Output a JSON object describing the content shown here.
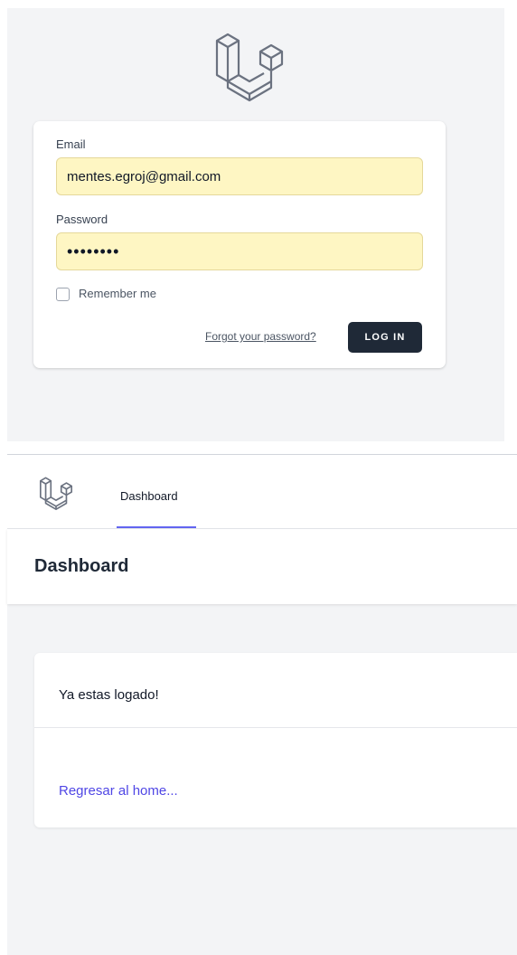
{
  "login": {
    "email_label": "Email",
    "email_value": "mentes.egroj@gmail.com",
    "password_label": "Password",
    "password_value": "........",
    "remember_label": "Remember me",
    "forgot_label": "Forgot your password?",
    "login_button_label": "LOG IN",
    "logo_icon": "laravel-logo-icon"
  },
  "dashboard": {
    "nav_logo_icon": "laravel-logo-icon",
    "nav_item_label": "Dashboard",
    "header_title": "Dashboard",
    "message": "Ya estas logado!",
    "home_link_label": "Regresar al home..."
  },
  "colors": {
    "background": "#f3f4f6",
    "input_autofill": "#fef6c3",
    "button": "#1f2937",
    "accent": "#6366f1",
    "link": "#4f46e5"
  }
}
